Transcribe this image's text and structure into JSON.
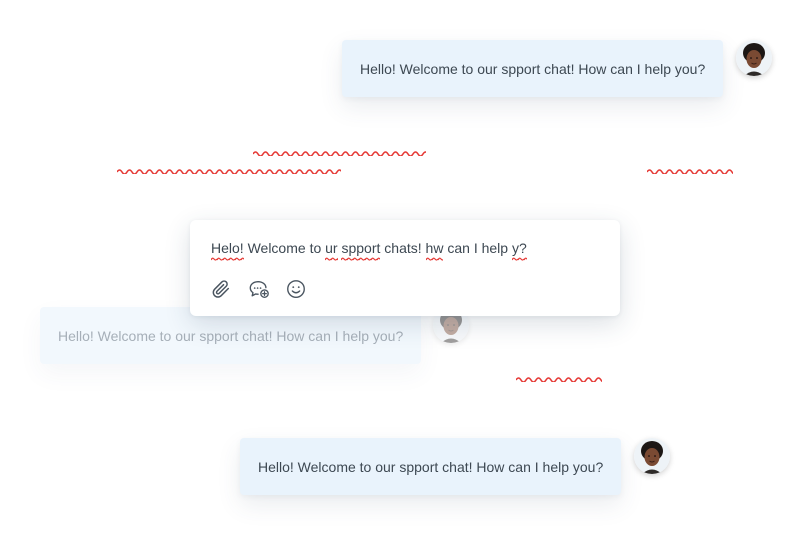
{
  "messages": [
    {
      "text": "Hello! Welcome to our spport chat! How can I help you?"
    },
    {
      "text": "Hello! Welcome to our spport chat! How can I help you?"
    },
    {
      "text": "Hello! Welcome to our spport chat! How can I help you?"
    }
  ],
  "composer": {
    "words": [
      "Helo!",
      "Welcome",
      "to",
      "ur",
      "spport",
      "chats!",
      "hw",
      "can",
      "I",
      "help",
      "y?"
    ],
    "misspelled": [
      true,
      false,
      false,
      true,
      true,
      false,
      true,
      false,
      false,
      false,
      true
    ]
  },
  "toolbar": {
    "attach_icon": "paperclip-icon",
    "chat_icon": "chat-add-icon",
    "emoji_icon": "smiley-icon"
  },
  "colors": {
    "bubble": "#e9f3fc",
    "bubble_faded": "#f2f8fd",
    "spellcheck": "#e53935",
    "text": "#3d4852"
  }
}
